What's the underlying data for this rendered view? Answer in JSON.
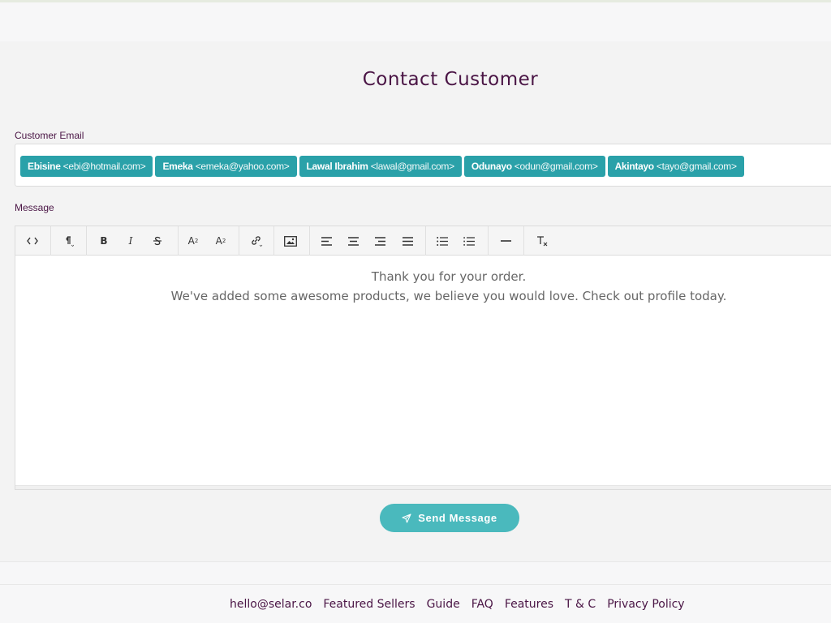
{
  "page": {
    "title": "Contact Customer"
  },
  "form": {
    "email_label": "Customer Email",
    "message_label": "Message",
    "recipients": [
      {
        "name": "Ebisine",
        "email": "<ebi@hotmail.com>"
      },
      {
        "name": "Emeka",
        "email": "<emeka@yahoo.com>"
      },
      {
        "name": "Lawal Ibrahim",
        "email": "<lawal@gmail.com>"
      },
      {
        "name": "Odunayo",
        "email": "<odun@gmail.com>"
      },
      {
        "name": "Akintayo",
        "email": "<tayo@gmail.com>"
      }
    ],
    "message_lines": [
      "Thank you for your order.",
      "We've added some awesome products, we believe you would love. Check out profile today."
    ],
    "send_label": "Send Message"
  },
  "toolbar": {
    "icons": [
      "code-view-icon",
      "paragraph-icon",
      "bold-icon",
      "italic-icon",
      "strikethrough-icon",
      "superscript-icon",
      "subscript-icon",
      "link-icon",
      "image-icon",
      "align-left-icon",
      "align-center-icon",
      "align-right-icon",
      "justify-icon",
      "bullet-list-icon",
      "numbered-list-icon",
      "horizontal-rule-icon",
      "clear-format-icon"
    ]
  },
  "footer": {
    "links": [
      "hello@selar.co",
      "Featured Sellers",
      "Guide",
      "FAQ",
      "Features",
      "T & C",
      "Privacy Policy"
    ]
  },
  "colors": {
    "brand": "#4a1545",
    "chip": "#2aa1a9",
    "button": "#4ab9bd"
  }
}
